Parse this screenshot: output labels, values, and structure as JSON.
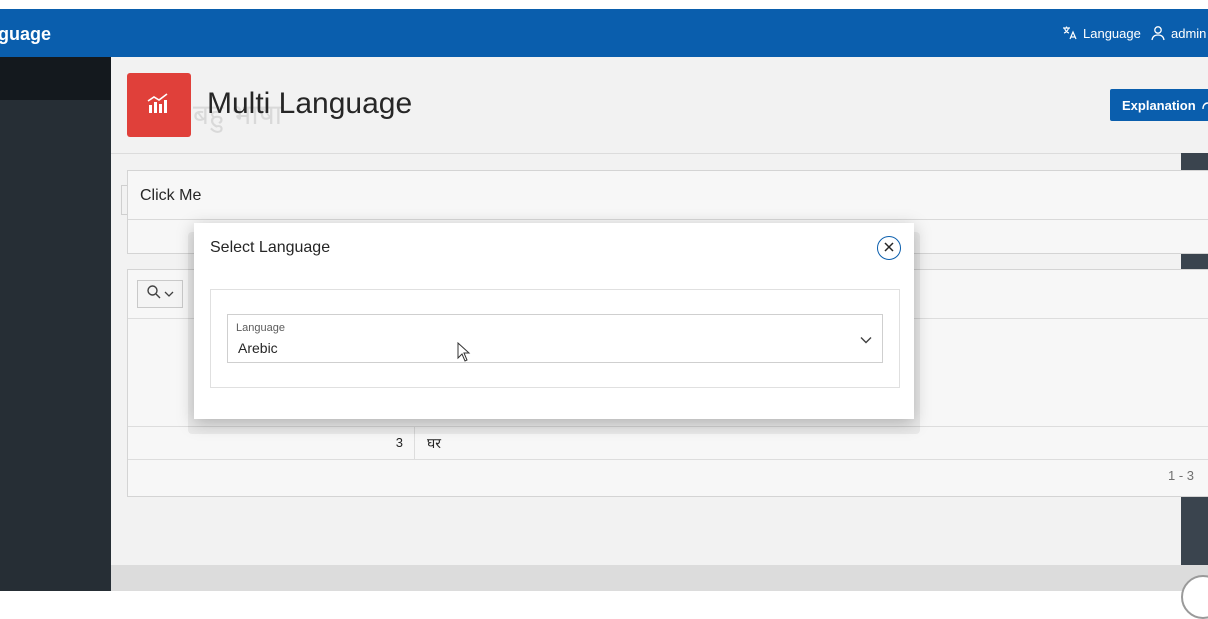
{
  "header": {
    "app_title": "guage",
    "nav_language_label": "Language",
    "nav_user_label": "admin"
  },
  "page": {
    "title": "Multi Language",
    "ghost_title": "बहु भाषा",
    "explanation_button": "Explanation"
  },
  "region_click": {
    "title": "Click Me"
  },
  "report": {
    "rows": [
      {
        "num": "3",
        "value": "घर"
      }
    ],
    "pagination": "1 - 3"
  },
  "modal": {
    "title": "Select Language",
    "field_label": "Language",
    "field_value": "Arebic"
  },
  "colors": {
    "header_bg": "#0a5ead",
    "sidebar_bg": "#262e35",
    "hero_icon_bg": "#e0403a"
  },
  "icons": {
    "language": "translate-icon",
    "user": "user-icon",
    "hero": "chart-icon",
    "explanation": "share-arrow-icon",
    "search": "search-icon",
    "close": "close-icon",
    "select": "chevron-down-icon"
  }
}
